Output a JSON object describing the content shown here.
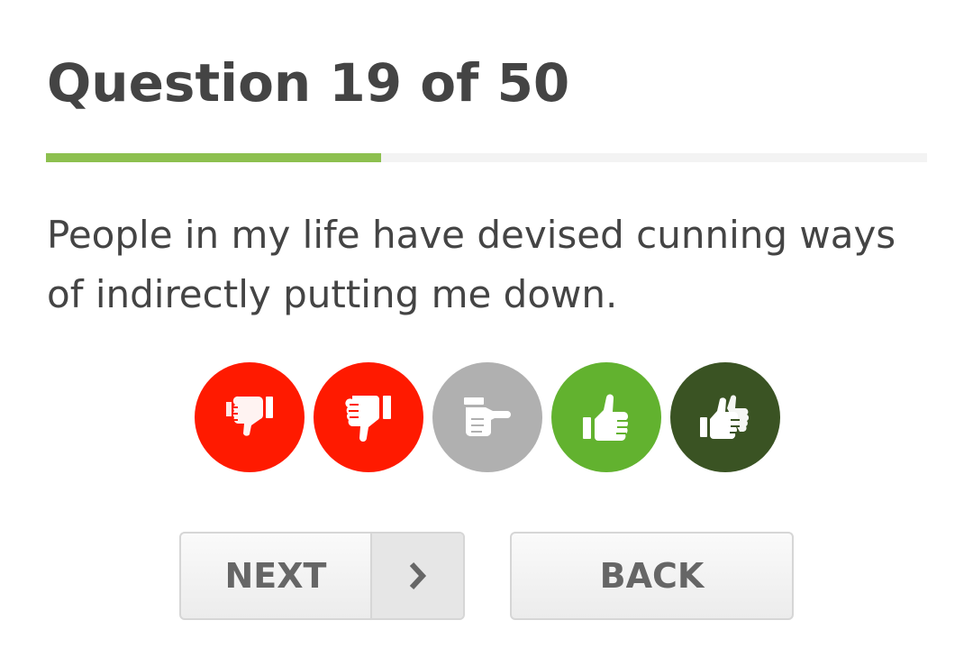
{
  "header": {
    "title": "Question 19 of 50"
  },
  "progress": {
    "current": 19,
    "total": 50,
    "fraction": 0.38,
    "colors": {
      "fill": "#8dc04f",
      "track": "#f3f3f3"
    }
  },
  "question": {
    "text": "People in my life have devised cunning ways of indirectly putting me down."
  },
  "answers": [
    {
      "icon": "thumbs-down-double-icon",
      "color": "#ff1a00"
    },
    {
      "icon": "thumbs-down-icon",
      "color": "#ff1a00"
    },
    {
      "icon": "thumb-sideways-icon",
      "color": "#b0b0b0"
    },
    {
      "icon": "thumbs-up-icon",
      "color": "#62b22f"
    },
    {
      "icon": "thumbs-up-double-icon",
      "color": "#3a5323"
    }
  ],
  "nav": {
    "next_label": "NEXT",
    "back_label": "BACK",
    "next_icon": "chevron-right-icon"
  }
}
